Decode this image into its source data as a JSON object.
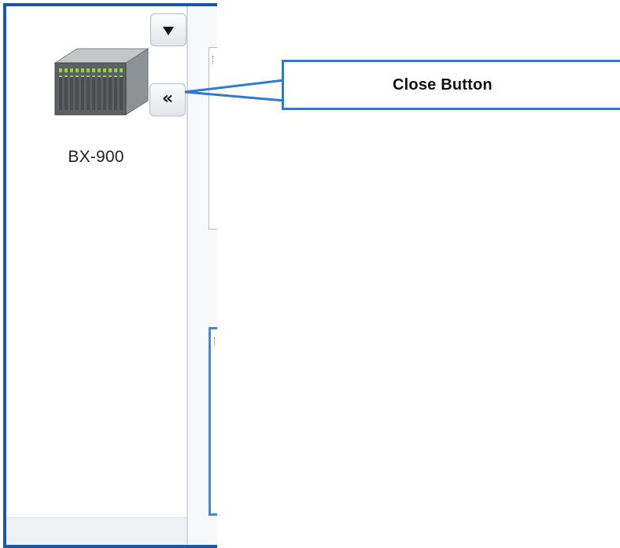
{
  "device": {
    "label": "BX-900",
    "icon": "server-chassis-icon"
  },
  "buttons": {
    "dropdown_icon": "caret-down-icon",
    "close_icon": "double-chevron-left-icon",
    "close_glyph": "«"
  },
  "callout": {
    "text": "Close Button"
  },
  "colors": {
    "window_border": "#1c56a8",
    "callout_border": "#2c7bd0",
    "selected_frame": "#4a86d8",
    "device_led": "#8fd14f"
  }
}
